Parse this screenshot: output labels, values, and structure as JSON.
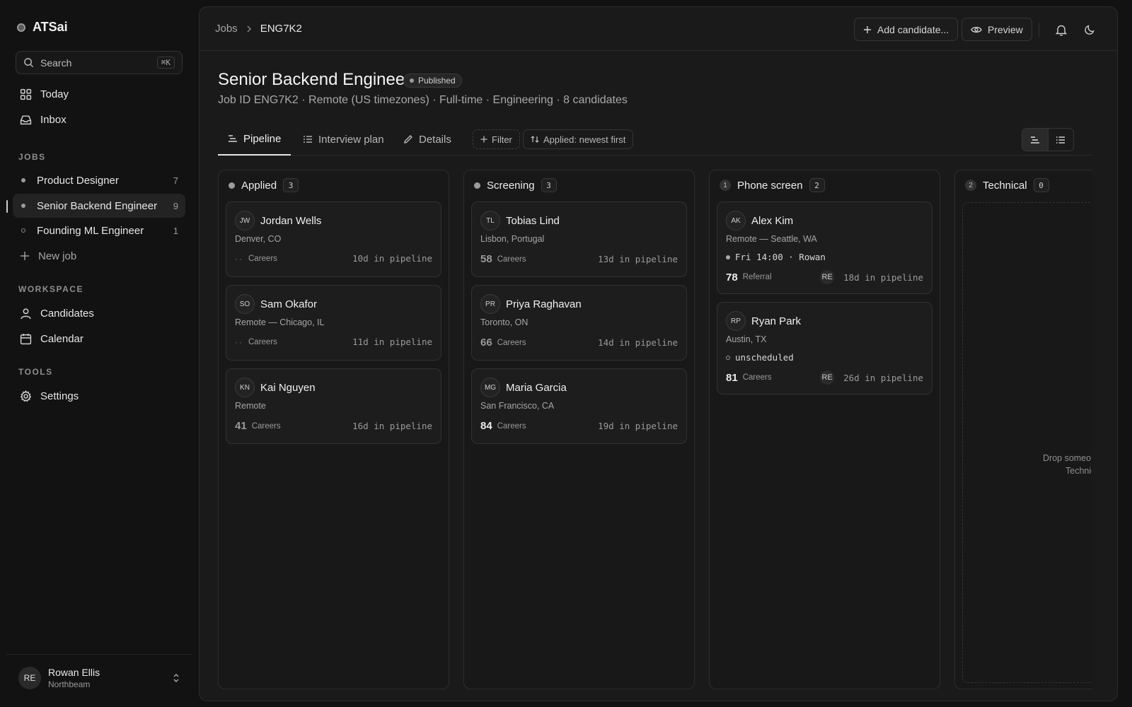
{
  "app": {
    "name": "ATSai"
  },
  "search": {
    "placeholder": "Search",
    "shortcut": "⌘K"
  },
  "nav": {
    "today": "Today",
    "inbox": "Inbox"
  },
  "jobs_section": {
    "label": "JOBS",
    "items": [
      {
        "label": "Product Designer",
        "count": "7"
      },
      {
        "label": "Senior Backend Engineer",
        "count": "9"
      },
      {
        "label": "Founding ML Engineer",
        "count": "1"
      }
    ],
    "new_job": "New job"
  },
  "workspace_section": {
    "label": "WORKSPACE",
    "candidates": "Candidates",
    "calendar": "Calendar"
  },
  "tools_section": {
    "label": "TOOLS",
    "settings": "Settings"
  },
  "user": {
    "initials": "RE",
    "name": "Rowan Ellis",
    "org": "Northbeam"
  },
  "breadcrumb": {
    "root": "Jobs",
    "current": "ENG7K2"
  },
  "toolbar": {
    "add_candidate": "Add candidate...",
    "preview": "Preview"
  },
  "job": {
    "title": "Senior Backend Engineer",
    "status": "Published",
    "meta": "Job ID ENG7K2 · Remote (US timezones) · Full-time · Engineering · 8 candidates"
  },
  "tabs": {
    "pipeline": "Pipeline",
    "interview_plan": "Interview plan",
    "details": "Details"
  },
  "filters": {
    "filter": "Filter",
    "sort": "Applied: newest first"
  },
  "columns": [
    {
      "name": "Applied",
      "count": "3",
      "cards": [
        {
          "initials": "JW",
          "name": "Jordan Wells",
          "location": "Denver, CO",
          "score": "··",
          "source": "Careers",
          "age": "10d in pipeline"
        },
        {
          "initials": "SO",
          "name": "Sam Okafor",
          "location": "Remote — Chicago, IL",
          "score": "··",
          "source": "Careers",
          "age": "11d in pipeline"
        },
        {
          "initials": "KN",
          "name": "Kai Nguyen",
          "location": "Remote",
          "score": "41",
          "source": "Careers",
          "age": "16d in pipeline"
        }
      ]
    },
    {
      "name": "Screening",
      "count": "3",
      "cards": [
        {
          "initials": "TL",
          "name": "Tobias Lind",
          "location": "Lisbon, Portugal",
          "score": "58",
          "source": "Careers",
          "age": "13d in pipeline"
        },
        {
          "initials": "PR",
          "name": "Priya Raghavan",
          "location": "Toronto, ON",
          "score": "66",
          "source": "Careers",
          "age": "14d in pipeline"
        },
        {
          "initials": "MG",
          "name": "Maria Garcia",
          "location": "San Francisco, CA",
          "score": "84",
          "source": "Careers",
          "age": "19d in pipeline"
        }
      ]
    },
    {
      "name": "Phone screen",
      "step": "1",
      "count": "2",
      "cards": [
        {
          "initials": "AK",
          "name": "Alex Kim",
          "location": "Remote — Seattle, WA",
          "schedule": "Fri 14:00 · Rowan",
          "score": "78",
          "source": "Referral",
          "reviewer": "RE",
          "age": "18d in pipeline"
        },
        {
          "initials": "RP",
          "name": "Ryan Park",
          "location": "Austin, TX",
          "schedule": "unscheduled",
          "score": "81",
          "source": "Careers",
          "reviewer": "RE",
          "age": "26d in pipeline"
        }
      ]
    },
    {
      "name": "Technical",
      "step": "2",
      "count": "0",
      "empty_line1": "Drop someone here t",
      "empty_line2": "Technical"
    }
  ],
  "icons": [
    "search-icon",
    "grid-icon",
    "inbox-icon",
    "plus-icon",
    "user-icon",
    "calendar-icon",
    "gear-icon",
    "chevron-right-icon",
    "eye-icon",
    "bell-icon",
    "moon-icon",
    "pipeline-icon",
    "list-icon",
    "pencil-icon",
    "sort-icon",
    "chevron-updown-icon"
  ]
}
